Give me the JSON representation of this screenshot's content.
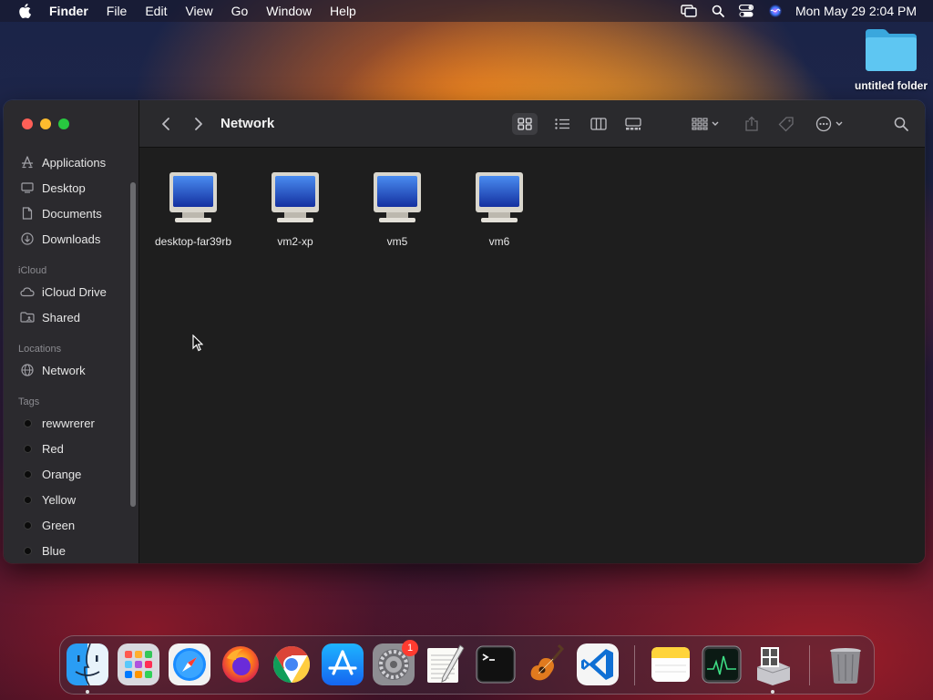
{
  "menubar": {
    "app_name": "Finder",
    "menus": [
      "File",
      "Edit",
      "View",
      "Go",
      "Window",
      "Help"
    ],
    "clock": "Mon May 29  2:04 PM"
  },
  "desktop": {
    "folder_label": "untitled folder"
  },
  "window": {
    "title": "Network",
    "sidebar": {
      "favorites": [
        "Applications",
        "Desktop",
        "Documents",
        "Downloads"
      ],
      "icloud_header": "iCloud",
      "icloud": [
        "iCloud Drive",
        "Shared"
      ],
      "locations_header": "Locations",
      "locations": [
        "Network"
      ],
      "tags_header": "Tags",
      "tags": [
        "rewwrerer",
        "Red",
        "Orange",
        "Yellow",
        "Green",
        "Blue"
      ]
    },
    "items": [
      "desktop-far39rb",
      "vm2-xp",
      "vm5",
      "vm6"
    ]
  },
  "dock": {
    "apps": [
      "Finder",
      "Launchpad",
      "Safari",
      "Firefox",
      "Chrome",
      "App Store",
      "System Settings",
      "TextEdit",
      "Terminal",
      "GarageBand",
      "Visual Studio Code",
      "Notes",
      "Activity Monitor",
      "Boot Camp Assistant",
      "Trash"
    ],
    "settings_badge": "1"
  },
  "colors": {
    "accent_close": "#fe5f57",
    "accent_min": "#febc2e",
    "accent_max": "#28c840",
    "badge": "#ff3b30"
  }
}
